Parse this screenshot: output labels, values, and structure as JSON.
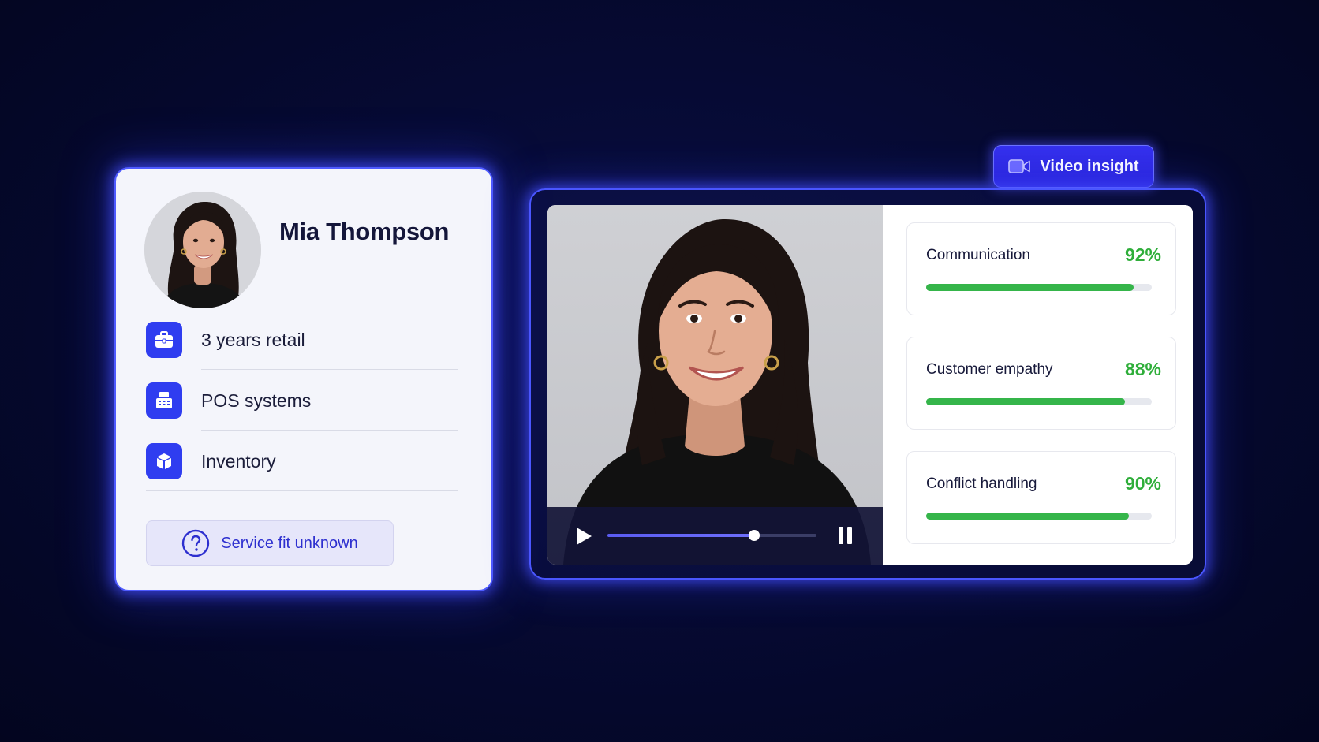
{
  "profile": {
    "name": "Mia Thompson",
    "avatar_icon": "candidate-photo",
    "skills": [
      {
        "label": "3 years retail",
        "icon": "briefcase-icon"
      },
      {
        "label": "POS systems",
        "icon": "pos-register-icon"
      },
      {
        "label": "Inventory",
        "icon": "box-icon"
      }
    ],
    "fit_status": {
      "label": "Service fit unknown",
      "icon": "question-circle-icon"
    }
  },
  "video_insight": {
    "chip_label": "Video insight",
    "chip_icon": "video-camera-icon",
    "player": {
      "progress_fraction": 0.7,
      "play_icon": "play-icon",
      "pause_icon": "pause-icon"
    },
    "metrics": [
      {
        "name": "Communication",
        "value": "92%",
        "fraction": 0.92
      },
      {
        "name": "Customer empathy",
        "value": "88%",
        "fraction": 0.88
      },
      {
        "name": "Conflict handling",
        "value": "90%",
        "fraction": 0.9
      }
    ]
  },
  "colors": {
    "accent": "#2f3df0",
    "glow": "#4f5bff",
    "score_green": "#2fae3a",
    "background": "#060a33"
  }
}
